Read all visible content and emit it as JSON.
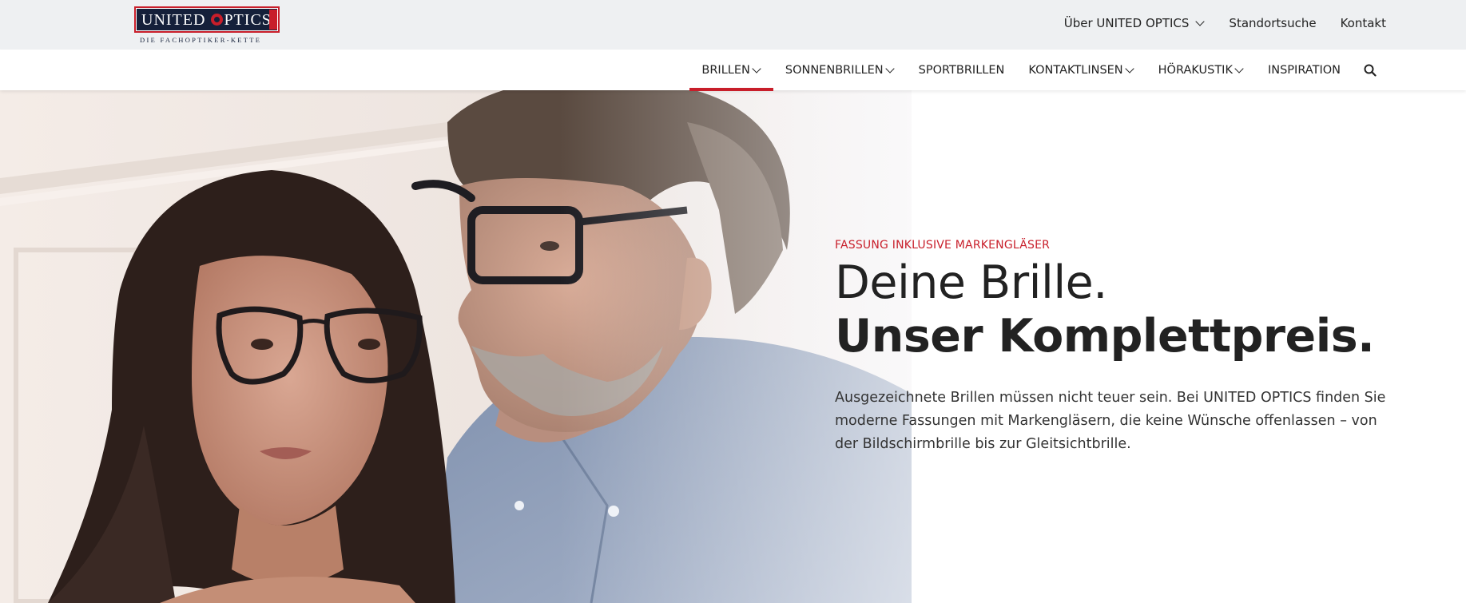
{
  "brand": {
    "logo_text_left": "UNITED",
    "logo_text_right": "PTICS",
    "tagline": "DIE FACHOPTIKER-KETTE",
    "accent_color": "#c81e2a",
    "navy_color": "#15203a"
  },
  "util_nav": {
    "items": [
      {
        "label": "Über UNITED OPTICS",
        "has_dropdown": true
      },
      {
        "label": "Standortsuche",
        "has_dropdown": false
      },
      {
        "label": "Kontakt",
        "has_dropdown": false
      }
    ]
  },
  "main_nav": {
    "items": [
      {
        "label": "BRILLEN",
        "has_dropdown": true,
        "active": true
      },
      {
        "label": "SONNENBRILLEN",
        "has_dropdown": true,
        "active": false
      },
      {
        "label": "SPORTBRILLEN",
        "has_dropdown": false,
        "active": false
      },
      {
        "label": "KONTAKTLINSEN",
        "has_dropdown": true,
        "active": false
      },
      {
        "label": "HÖRAKUSTIK",
        "has_dropdown": true,
        "active": false
      },
      {
        "label": "INSPIRATION",
        "has_dropdown": false,
        "active": false
      }
    ],
    "search_icon": "search-icon"
  },
  "hero": {
    "eyebrow": "FASSUNG INKLUSIVE MARKENGLÄSER",
    "headline_line1": "Deine Brille.",
    "headline_line2": "Unser Komplettpreis.",
    "description": "Ausgezeichnete Brillen müssen nicht teuer sein. Bei UNITED OPTICS finden Sie moderne Fassungen mit Markengläsern, die keine Wünsche offenlassen – von der Bildschirmbrille bis zur Gleitsichtbrille."
  }
}
